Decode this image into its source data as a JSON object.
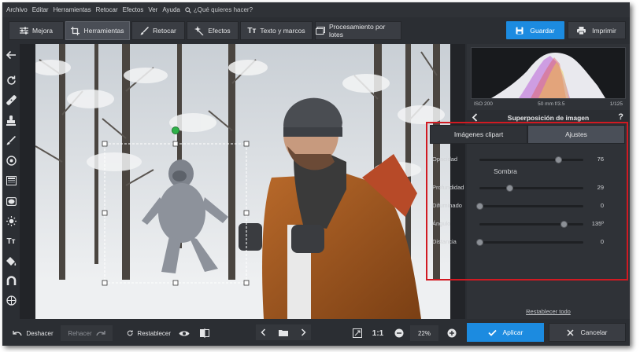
{
  "menu": {
    "items": [
      "Archivo",
      "Editar",
      "Herramientas",
      "Retocar",
      "Efectos",
      "Ver",
      "Ayuda"
    ],
    "search_placeholder": "¿Qué quieres hacer?"
  },
  "toolbar": {
    "tabs": [
      {
        "label": "Mejora",
        "icon": "sliders-icon"
      },
      {
        "label": "Herramientas",
        "icon": "crop-icon"
      },
      {
        "label": "Retocar",
        "icon": "brush-icon"
      },
      {
        "label": "Efectos",
        "icon": "sparkle-icon"
      },
      {
        "label": "Texto y marcos",
        "icon": "text-icon"
      },
      {
        "label": "Procesamiento por lotes",
        "icon": "batch-icon"
      }
    ],
    "active_tab": "Herramientas",
    "save_label": "Guardar",
    "print_label": "Imprimir"
  },
  "histogram": {
    "iso": "ISO 200",
    "lens": "50 mm f/3.5",
    "shutter": "1/125"
  },
  "panel": {
    "title": "Superposición de imagen",
    "help": "?",
    "tabs": [
      "Imágenes clipart",
      "Ajustes"
    ],
    "selected_tab": "Ajustes",
    "section_label": "Sombra",
    "sliders": [
      {
        "label": "Opacidad",
        "value": "76",
        "fraction": 0.76
      },
      {
        "label": "Profundidad",
        "value": "29",
        "fraction": 0.29
      },
      {
        "label": "Difuminado",
        "value": "0",
        "fraction": 0.0
      },
      {
        "label": "Ángulo",
        "value": "135º",
        "fraction": 0.81
      },
      {
        "label": "Distancia",
        "value": "0",
        "fraction": 0.0
      }
    ],
    "reset_label": "Restablecer todo"
  },
  "bottom": {
    "undo": "Deshacer",
    "redo": "Rehacer",
    "restore": "Restablecer",
    "one_to_one": "1:1",
    "zoom": "22%",
    "apply": "Aplicar",
    "cancel": "Cancelar"
  },
  "colors": {
    "accent": "#1c8be0",
    "highlight": "#d11a22",
    "bg": "#2b2e33"
  }
}
